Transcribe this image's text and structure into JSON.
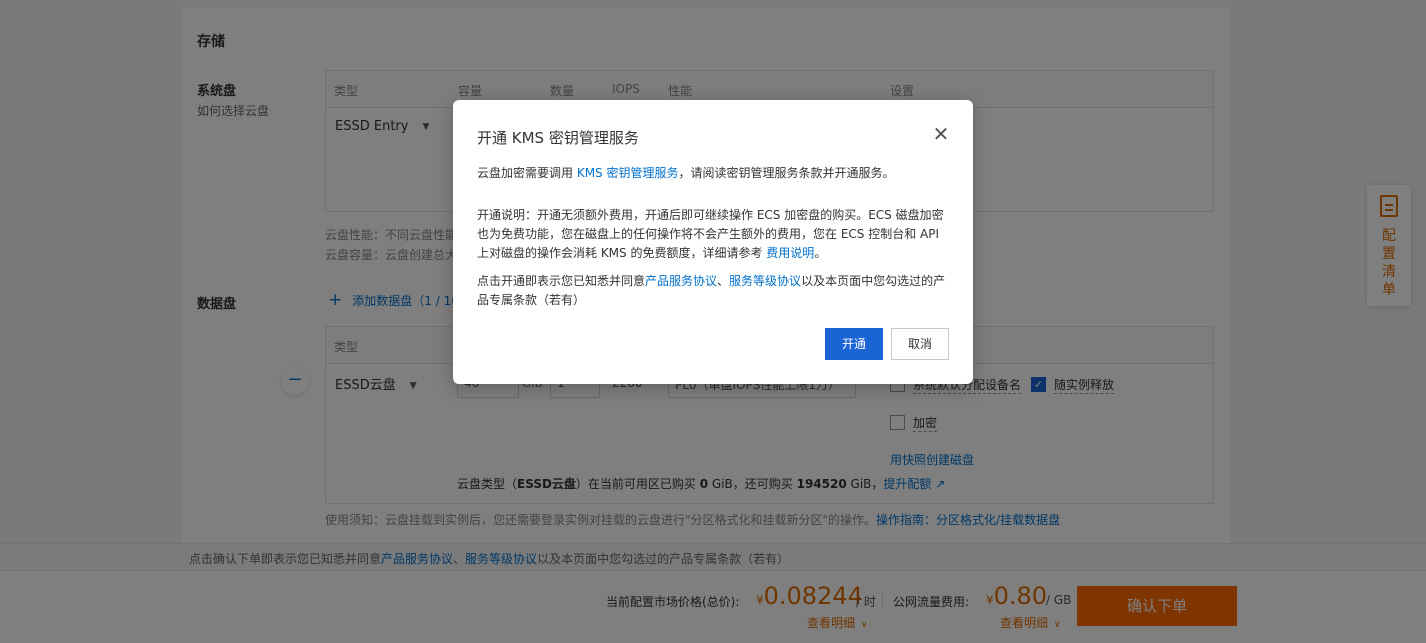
{
  "storage": {
    "title": "存储",
    "system_disk": {
      "label": "系统盘",
      "help_link": "如何选择云盘",
      "columns": [
        "类型",
        "容量",
        "数量",
        "IOPS",
        "性能",
        "设置"
      ],
      "type_value": "ESSD Entry",
      "hint_performance": "云盘性能：不同云盘性能",
      "hint_capacity": "云盘容量：云盘创建总大"
    },
    "data_disk": {
      "label": "数据盘",
      "add_button": "添加数据盘",
      "add_count": "（1 / 16",
      "columns": [
        "类型"
      ],
      "type_value": "ESSD云盘",
      "capacity": "40",
      "capacity_unit": "GiB",
      "quantity": "1",
      "iops": "2280",
      "performance": "PL0（单盘IOPS性能上限1万）",
      "device_name_label": "系统默认分配设备名",
      "release_label": "随实例释放",
      "encrypt_label": "加密",
      "snapshot_link": "用快照创建磁盘",
      "quota_prefix": "云盘类型（",
      "quota_type": "ESSD云盘",
      "quota_mid1": "）在当前可用区已购买 ",
      "quota_bought": "0",
      "quota_mid2": " GiB，还可购买 ",
      "quota_left": "194520",
      "quota_mid3": " GiB，",
      "quota_link": "提升配额",
      "usage_notice": "使用须知：云盘挂载到实例后，您还需要登录实例对挂载的云盘进行\"分区格式化和挂载新分区\"的操作。",
      "usage_link": "操作指南：分区格式化/挂载数据盘"
    }
  },
  "side_float": {
    "icon": "document-icon",
    "label": "配置清单"
  },
  "bottom": {
    "notice_prefix": "点击确认下单即表示您已知悉并同意",
    "notice_link1": "产品服务协议",
    "notice_sep": "、",
    "notice_link2": "服务等级协议",
    "notice_suffix": "以及本页面中您勾选过的产品专属条款（若有）",
    "price_label": "当前配置市场价格(总价):",
    "currency": "¥",
    "price_value": "0.08244",
    "price_unit": "/ 时",
    "traffic_label": "公网流量费用:",
    "traffic_value": "0.80",
    "traffic_unit": "/ GB",
    "detail_label": "查看明细",
    "order_button": "确认下单"
  },
  "modal": {
    "title": "开通 KMS 密钥管理服务",
    "p1_prefix": "云盘加密需要调用 ",
    "p1_link": "KMS 密钥管理服务",
    "p1_suffix": "，请阅读密钥管理服务条款并开通服务。",
    "p2_text": "开通说明：开通无须额外费用，开通后即可继续操作 ECS 加密盘的购买。ECS 磁盘加密也为免费功能，您在磁盘上的任何操作将不会产生额外的费用，您在 ECS 控制台和 API 上对磁盘的操作会消耗 KMS 的免费额度，详细请参考 ",
    "p2_link": "费用说明",
    "p2_end": "。",
    "p3_prefix": "点击开通即表示您已知悉并同意",
    "p3_link1": "产品服务协议",
    "p3_sep": "、",
    "p3_link2": "服务等级协议",
    "p3_suffix": "以及本页面中您勾选过的产品专属条款（若有）",
    "confirm_button": "开通",
    "cancel_button": "取消"
  }
}
